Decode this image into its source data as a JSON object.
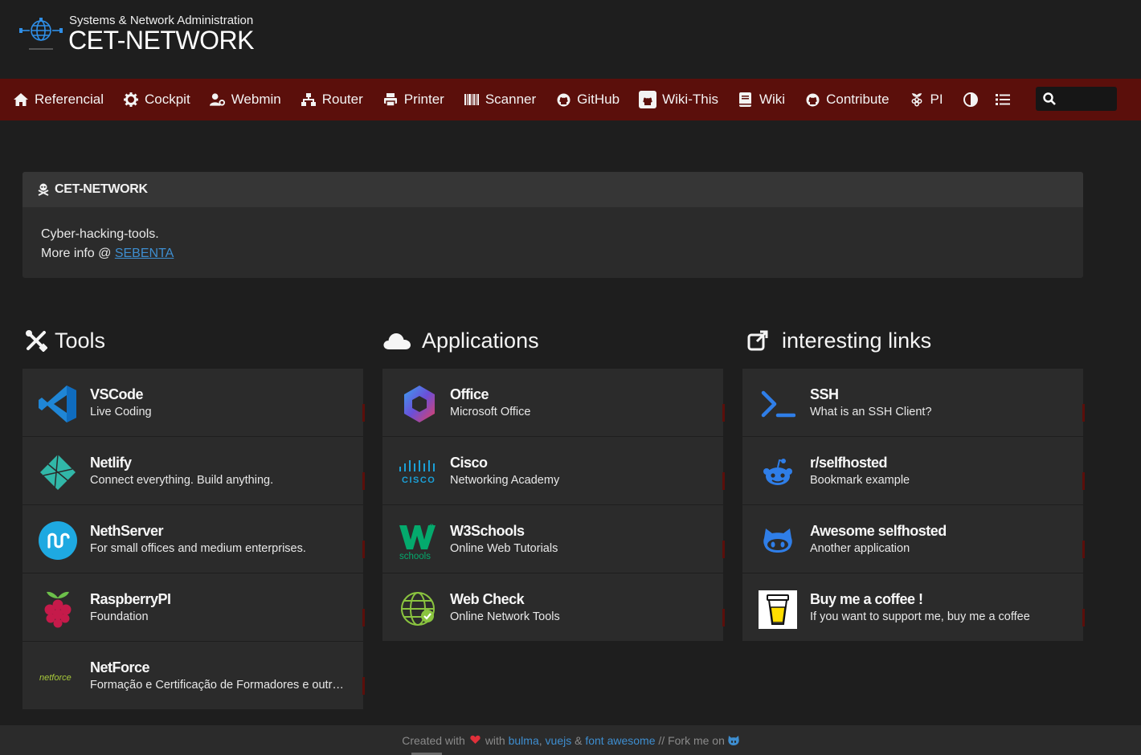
{
  "header": {
    "subtitle": "Systems & Network Administration",
    "title": "CET-NETWORK"
  },
  "nav": {
    "items": [
      {
        "label": "Referencial",
        "icon": "home-icon"
      },
      {
        "label": "Cockpit",
        "icon": "gear-icon"
      },
      {
        "label": "Webmin",
        "icon": "user-cog-icon"
      },
      {
        "label": "Router",
        "icon": "network-icon"
      },
      {
        "label": "Printer",
        "icon": "printer-icon"
      },
      {
        "label": "Scanner",
        "icon": "barcode-icon"
      },
      {
        "label": "GitHub",
        "icon": "github-icon"
      },
      {
        "label": "Wiki-This",
        "icon": "github-square-icon"
      },
      {
        "label": "Wiki",
        "icon": "book-icon"
      },
      {
        "label": "Contribute",
        "icon": "github-icon"
      },
      {
        "label": "PI",
        "icon": "raspberry-pi-icon"
      }
    ],
    "theme_icon": "contrast-icon",
    "layout_icon": "list-icon",
    "search_icon": "search-icon"
  },
  "message": {
    "title": "CET-NETWORK",
    "line1": "Cyber-hacking-tools.",
    "line2_prefix": "More info @ ",
    "line2_link": "SEBENTA"
  },
  "groups": [
    {
      "name": "Tools",
      "icon": "tools-icon",
      "items": [
        {
          "title": "VSCode",
          "subtitle": "Live Coding",
          "logo": "vscode-logo"
        },
        {
          "title": "Netlify",
          "subtitle": "Connect everything. Build anything.",
          "logo": "netlify-logo"
        },
        {
          "title": "NethServer",
          "subtitle": "For small offices and medium enterprises.",
          "logo": "nethserver-logo"
        },
        {
          "title": "RaspberryPI",
          "subtitle": "Foundation",
          "logo": "raspberrypi-logo"
        },
        {
          "title": "NetForce",
          "subtitle": "Formação e Certificação de Formadores e outros...",
          "logo": "netforce-logo"
        }
      ]
    },
    {
      "name": "Applications",
      "icon": "cloud-icon",
      "items": [
        {
          "title": "Office",
          "subtitle": "Microsoft Office",
          "logo": "office-logo"
        },
        {
          "title": "Cisco",
          "subtitle": "Networking Academy",
          "logo": "cisco-logo"
        },
        {
          "title": "W3Schools",
          "subtitle": "Online Web Tutorials",
          "logo": "w3schools-logo"
        },
        {
          "title": "Web Check",
          "subtitle": "Online Network Tools",
          "logo": "webcheck-logo"
        }
      ]
    },
    {
      "name": "interesting links",
      "icon": "external-link-icon",
      "items": [
        {
          "title": "SSH",
          "subtitle": "What is an SSH Client?",
          "logo": "terminal-logo"
        },
        {
          "title": "r/selfhosted",
          "subtitle": "Bookmark example",
          "logo": "reddit-logo"
        },
        {
          "title": "Awesome selfhosted",
          "subtitle": "Another application",
          "logo": "github-logo"
        },
        {
          "title": "Buy me a coffee !",
          "subtitle": "If you want to support me, buy me a coffee",
          "logo": "coffee-logo"
        }
      ]
    }
  ],
  "footer": {
    "created_with": "Created with",
    "with": "with",
    "bulma": "bulma",
    "comma": ",",
    "vuejs": "vuejs",
    "amp": "&",
    "fontawesome": "font awesome",
    "fork": "// Fork me on"
  }
}
